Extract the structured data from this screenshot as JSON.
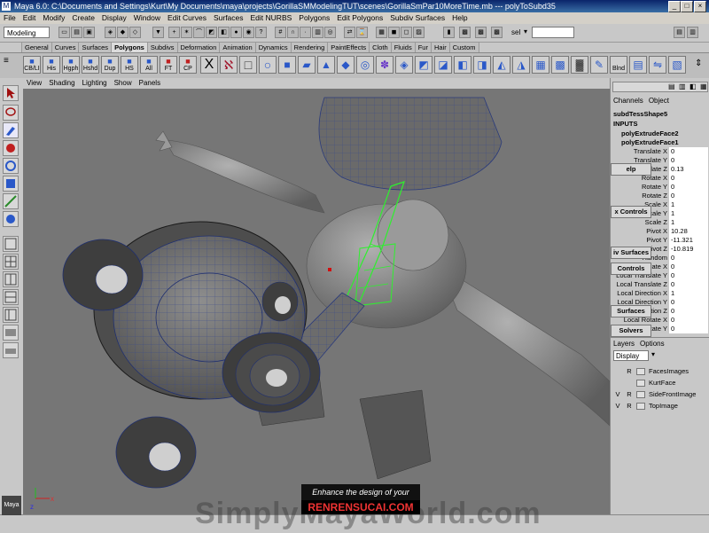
{
  "title": "Maya 6.0: C:\\Documents and Settings\\Kurt\\My Documents\\maya\\projects\\GorillaSMModelingTUT\\scenes\\GorillaSmPar10MoreTime.mb  ---  polyToSubd35",
  "menus": [
    "File",
    "Edit",
    "Modify",
    "Create",
    "Display",
    "Window",
    "Edit Curves",
    "Surfaces",
    "Edit NURBS",
    "Polygons",
    "Edit Polygons",
    "Subdiv Surfaces",
    "Help"
  ],
  "mode": "Modeling",
  "sel_label": "sel",
  "shelf_tabs": [
    "General",
    "Curves",
    "Surfaces",
    "Polygons",
    "Subdivs",
    "Deformation",
    "Animation",
    "Dynamics",
    "Rendering",
    "PaintEffects",
    "Cloth",
    "Fluids",
    "Fur",
    "Hair",
    "Custom"
  ],
  "active_shelf": "Polygons",
  "shelf_buttons": [
    "CB/LI",
    "His",
    "Hgph",
    "Hshd",
    "Dup",
    "HS",
    "All",
    "FT",
    "CP"
  ],
  "shelf_right": "Blnd",
  "viewport_menu": [
    "View",
    "Shading",
    "Lighting",
    "Show",
    "Panels"
  ],
  "axis": {
    "x": "x",
    "z": "z"
  },
  "channel_tabs": [
    "Channels",
    "Object"
  ],
  "shape_name": "subdTessShape5",
  "inputs_label": "INPUTS",
  "inputs": [
    "polyExtrudeFace2",
    "polyExtrudeFace1"
  ],
  "channels": [
    {
      "k": "Translate X",
      "v": "0"
    },
    {
      "k": "Translate Y",
      "v": "0"
    },
    {
      "k": "Translate Z",
      "v": "0.13"
    },
    {
      "k": "Rotate X",
      "v": "0"
    },
    {
      "k": "Rotate Y",
      "v": "0"
    },
    {
      "k": "Rotate Z",
      "v": "0"
    },
    {
      "k": "Scale X",
      "v": "1"
    },
    {
      "k": "Scale Y",
      "v": "1"
    },
    {
      "k": "Scale Z",
      "v": "1"
    },
    {
      "k": "Pivot X",
      "v": "10.28"
    },
    {
      "k": "Pivot Y",
      "v": "-11.321"
    },
    {
      "k": "Pivot Z",
      "v": "-10.819"
    },
    {
      "k": "Random",
      "v": "0"
    },
    {
      "k": "Local Translate X",
      "v": "0"
    },
    {
      "k": "Local Translate Y",
      "v": "0"
    },
    {
      "k": "Local Translate Z",
      "v": "0"
    },
    {
      "k": "Local Direction X",
      "v": "1"
    },
    {
      "k": "Local Direction Y",
      "v": "0"
    },
    {
      "k": "Local Direction Z",
      "v": "0"
    },
    {
      "k": "Local Rotate X",
      "v": "0"
    },
    {
      "k": "Local Rotate Y",
      "v": "0"
    }
  ],
  "overlay_buttons": [
    "elp",
    "x Controls",
    "iv Surfaces",
    "Controls",
    "Surfaces",
    "Solvers"
  ],
  "layer_tabs": [
    "Layers",
    "Options"
  ],
  "layer_mode": "Display",
  "layers": [
    {
      "v": "",
      "r": "R",
      "name": "FacesImages"
    },
    {
      "v": "",
      "r": "",
      "name": "KurtFace"
    },
    {
      "v": "V",
      "r": "R",
      "name": "SideFrontImage"
    },
    {
      "v": "V",
      "r": "R",
      "name": "TopImage"
    }
  ],
  "watermark": {
    "line1": "Enhance the design of your",
    "brand": "RENRENSUCAI.COM",
    "site": "SimplyMayaWorld.com"
  }
}
